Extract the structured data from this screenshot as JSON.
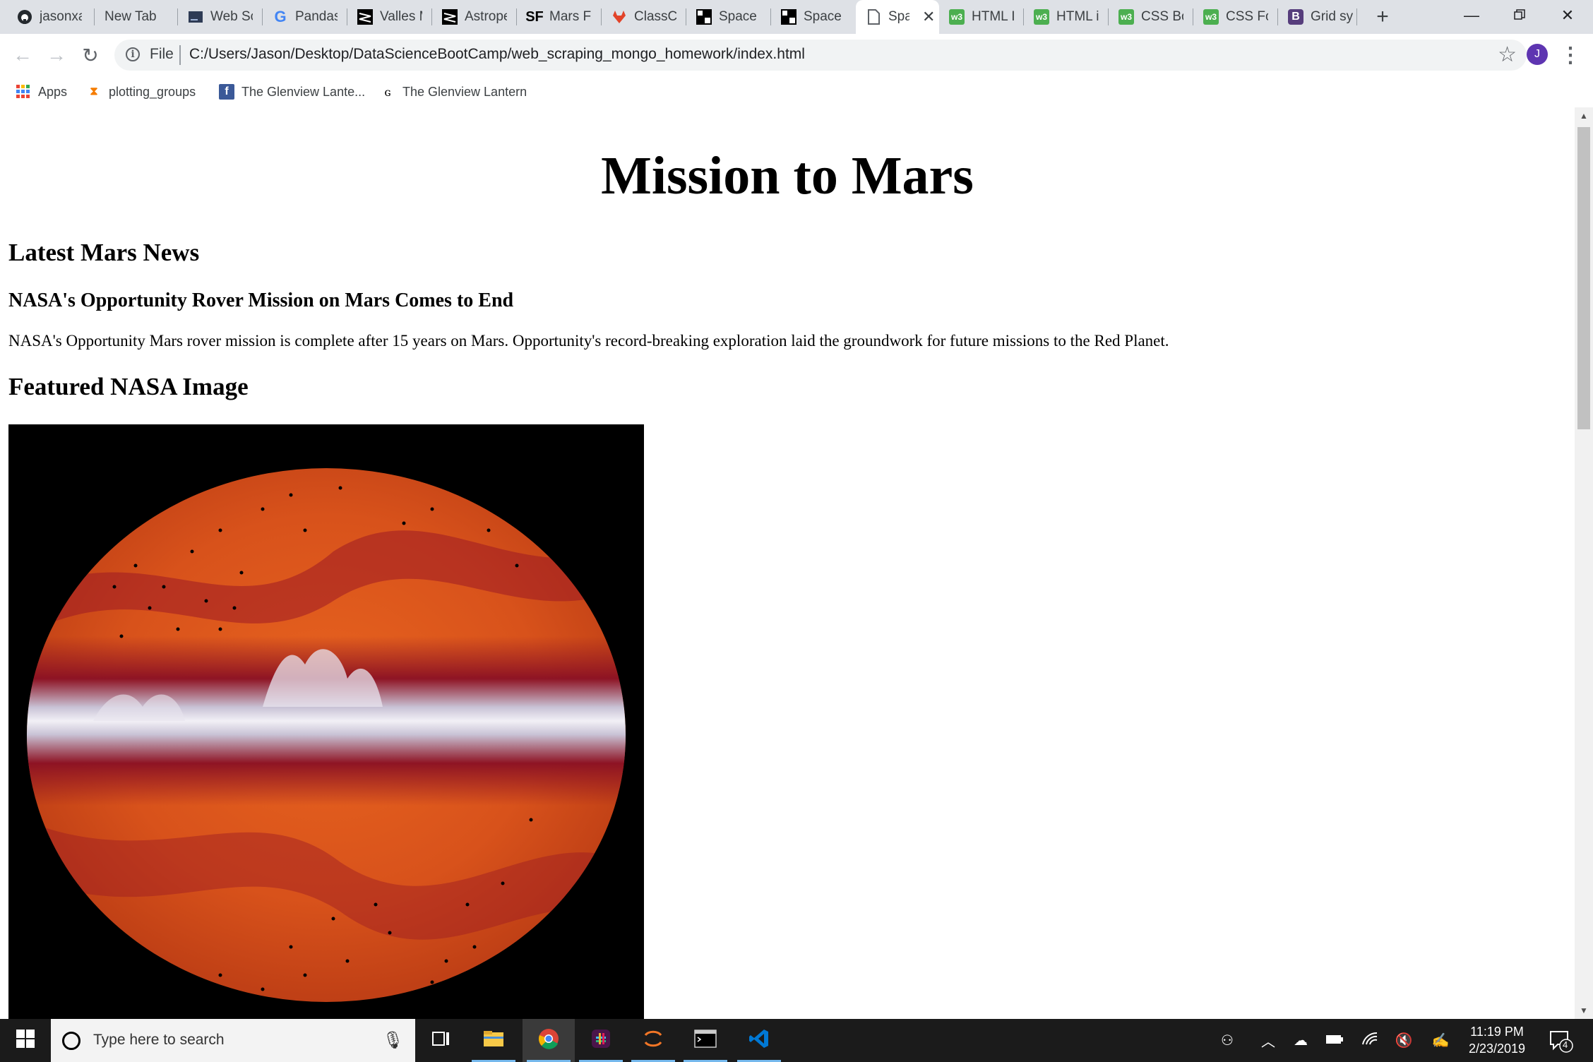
{
  "browser": {
    "tabs": [
      {
        "label": "jasonxa",
        "icon": "github-icon",
        "active": false
      },
      {
        "label": "New Tab",
        "icon": "",
        "active": false
      },
      {
        "label": "Web Sc",
        "icon": "page-thumbnail-icon",
        "active": false
      },
      {
        "label": "Pandas",
        "icon": "google-icon",
        "active": false
      },
      {
        "label": "Valles M",
        "icon": "nasa-jpl-icon",
        "active": false
      },
      {
        "label": "Astrope",
        "icon": "nasa-jpl-icon",
        "active": false
      },
      {
        "label": "Mars Fa",
        "icon": "sf-icon",
        "active": false
      },
      {
        "label": "ClassCo",
        "icon": "gitlab-icon",
        "active": false
      },
      {
        "label": "Space I",
        "icon": "space-images-icon",
        "active": false
      },
      {
        "label": "Space I",
        "icon": "space-images-icon",
        "active": false
      },
      {
        "label": "Spa",
        "icon": "document-icon",
        "active": true
      },
      {
        "label": "HTML I",
        "icon": "w3schools-icon",
        "active": false
      },
      {
        "label": "HTML i",
        "icon": "w3schools-icon",
        "active": false
      },
      {
        "label": "CSS Bo",
        "icon": "w3schools-icon",
        "active": false
      },
      {
        "label": "CSS Fo",
        "icon": "w3schools-icon",
        "active": false
      },
      {
        "label": "Grid sy",
        "icon": "bootstrap-icon",
        "active": false
      }
    ],
    "file_label": "File",
    "url": "C:/Users/Jason/Desktop/DataScienceBootCamp/web_scraping_mongo_homework/index.html",
    "avatar_letter": "J",
    "bookmarks": [
      {
        "label": "Apps",
        "icon": "apps-grid-icon"
      },
      {
        "label": "plotting_groups",
        "icon": "hourglass-icon"
      },
      {
        "label": "The Glenview Lante...",
        "icon": "facebook-icon"
      },
      {
        "label": "The Glenview Lantern",
        "icon": "glenview-lantern-logo-icon"
      }
    ]
  },
  "page": {
    "title": "Mission to Mars",
    "news_heading": "Latest Mars News",
    "news_title": "NASA's Opportunity Rover Mission on Mars Comes to End",
    "news_teaser": "NASA's Opportunity Mars rover mission is complete after 15 years on Mars. Opportunity's record-breaking exploration laid the groundwork for future missions to the Red Planet.",
    "image_heading": "Featured NASA Image"
  },
  "taskbar": {
    "search_placeholder": "Type here to search",
    "time": "11:19 PM",
    "date": "2/23/2019",
    "notification_count": "4"
  },
  "colors": {
    "tabstrip": "#dee1e6",
    "avatar": "#5e35b1",
    "w3schools": "#4caf50",
    "bootstrap": "#563d7c",
    "taskbar": "#1b1b1b",
    "map_orange": "#d8521b",
    "map_crimson": "#8a1024"
  }
}
